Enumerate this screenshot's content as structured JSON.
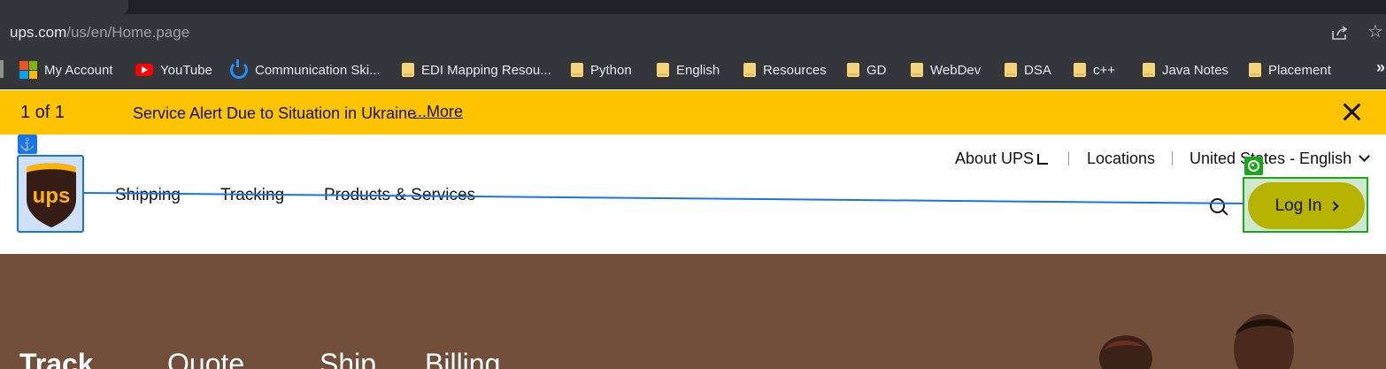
{
  "browser": {
    "url_host": "ups.com",
    "url_path": "/us/en/Home.page",
    "icons": {
      "share": "share-icon",
      "star": "bookmark-star-icon"
    }
  },
  "bookmarks": [
    {
      "label": "My Account",
      "icon": "microsoft-icon"
    },
    {
      "label": "YouTube",
      "icon": "youtube-icon"
    },
    {
      "label": "Communication Ski...",
      "icon": "power-icon"
    },
    {
      "label": "EDI Mapping Resou...",
      "icon": "folder-icon"
    },
    {
      "label": "Python",
      "icon": "folder-icon"
    },
    {
      "label": "English",
      "icon": "folder-icon"
    },
    {
      "label": "Resources",
      "icon": "folder-icon"
    },
    {
      "label": "GD",
      "icon": "folder-icon"
    },
    {
      "label": "WebDev",
      "icon": "folder-icon"
    },
    {
      "label": "DSA",
      "icon": "folder-icon"
    },
    {
      "label": "c++",
      "icon": "folder-icon"
    },
    {
      "label": "Java Notes",
      "icon": "folder-icon"
    },
    {
      "label": "Placement",
      "icon": "folder-icon"
    }
  ],
  "bookmarks_overflow": "»",
  "alert": {
    "count": "1 of 1",
    "text": "Service Alert Due to Situation in Ukraine",
    "more": "...More",
    "color": "#ffc400"
  },
  "header": {
    "nav": [
      "Shipping",
      "Tracking",
      "Products & Services"
    ],
    "utility": {
      "about": "About UPS",
      "locations": "Locations",
      "language": "United States - English"
    },
    "login": "Log In",
    "brand_colors": {
      "shield_brown": "#351c15",
      "shield_gold": "#ffb500"
    }
  },
  "hero": {
    "tabs": [
      "Track",
      "Quote",
      "Ship",
      "Billing"
    ],
    "background": "#714f3b"
  }
}
